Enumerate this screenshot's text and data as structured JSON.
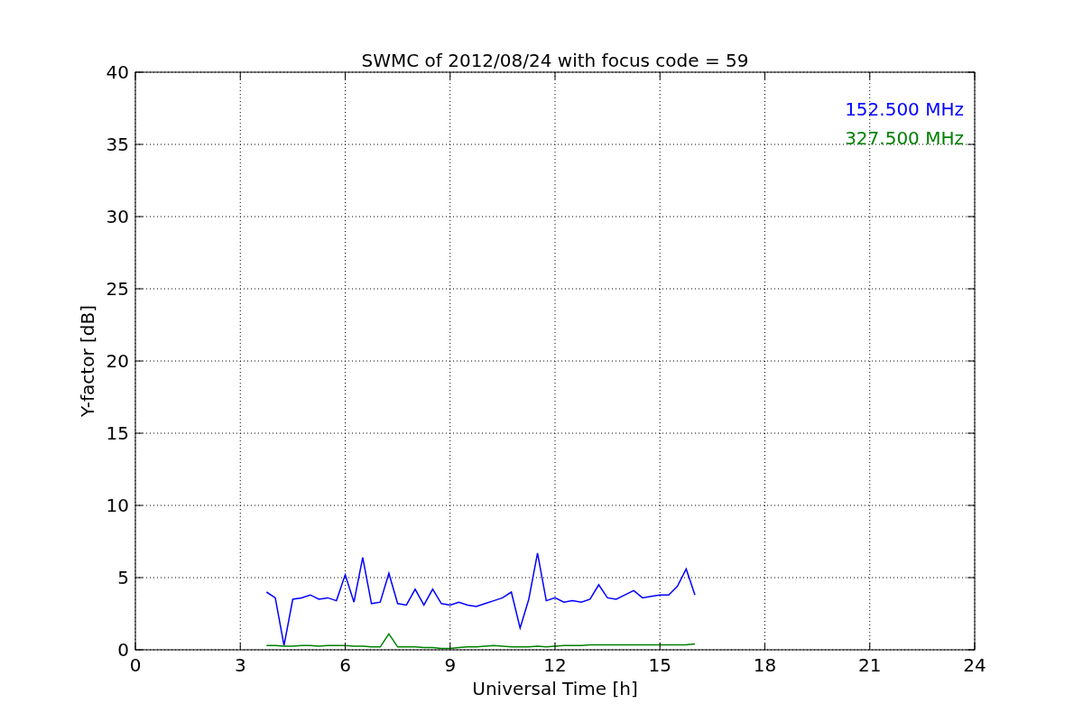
{
  "figure": {
    "chart_data": {
      "type": "line",
      "title": "SWMC of 2012/08/24 with focus code = 59",
      "xlabel": "Universal Time [h]",
      "ylabel": "Y-factor [dB]",
      "x": [
        3.75,
        4.0,
        4.25,
        4.5,
        4.75,
        5.0,
        5.25,
        5.5,
        5.75,
        6.0,
        6.25,
        6.5,
        6.75,
        7.0,
        7.25,
        7.5,
        7.75,
        8.0,
        8.25,
        8.5,
        8.75,
        9.0,
        9.25,
        9.5,
        9.75,
        10.0,
        10.25,
        10.5,
        10.75,
        11.0,
        11.25,
        11.5,
        11.75,
        12.0,
        12.25,
        12.5,
        12.75,
        13.0,
        13.25,
        13.5,
        13.75,
        14.0,
        14.25,
        14.5,
        14.75,
        15.0,
        15.25,
        15.5,
        15.75,
        16.0
      ],
      "series": [
        {
          "name": "152.500 MHz",
          "color": "#0000ff",
          "values": [
            4.0,
            3.6,
            0.3,
            3.5,
            3.6,
            3.8,
            3.5,
            3.6,
            3.4,
            5.2,
            3.3,
            6.4,
            3.2,
            3.3,
            5.3,
            3.2,
            3.1,
            4.2,
            3.1,
            4.2,
            3.2,
            3.1,
            3.3,
            3.1,
            3.0,
            3.2,
            3.4,
            3.6,
            4.0,
            1.5,
            3.5,
            6.7,
            3.4,
            3.6,
            3.3,
            3.4,
            3.3,
            3.5,
            4.5,
            3.6,
            3.5,
            3.8,
            4.1,
            3.6,
            3.7,
            3.8,
            3.8,
            4.4,
            5.6,
            3.8
          ]
        },
        {
          "name": "327.500 MHz",
          "color": "#008000",
          "values": [
            0.3,
            0.3,
            0.25,
            0.25,
            0.3,
            0.3,
            0.25,
            0.3,
            0.3,
            0.3,
            0.25,
            0.25,
            0.2,
            0.2,
            1.1,
            0.2,
            0.2,
            0.2,
            0.15,
            0.15,
            0.1,
            0.1,
            0.15,
            0.2,
            0.2,
            0.25,
            0.3,
            0.25,
            0.2,
            0.2,
            0.2,
            0.25,
            0.2,
            0.25,
            0.3,
            0.3,
            0.3,
            0.35,
            0.35,
            0.35,
            0.35,
            0.35,
            0.35,
            0.35,
            0.35,
            0.35,
            0.35,
            0.35,
            0.35,
            0.4
          ]
        }
      ],
      "grid": true,
      "xlim": [
        0,
        24
      ],
      "ylim": [
        0,
        40
      ],
      "xticks": [
        0,
        3,
        6,
        9,
        12,
        15,
        18,
        21,
        24
      ],
      "yticks": [
        0,
        5,
        10,
        15,
        20,
        25,
        30,
        35,
        40
      ]
    }
  }
}
